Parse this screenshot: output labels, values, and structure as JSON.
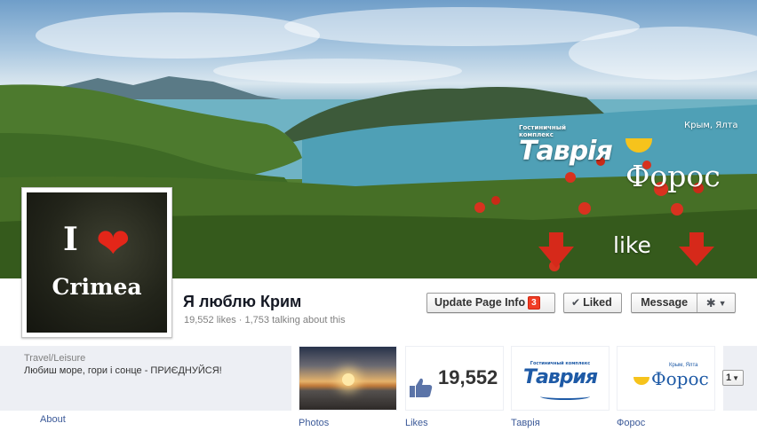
{
  "cover": {
    "brand_tavria": "Таврія",
    "brand_tavria_sub": "Гостиничный комплекс",
    "brand_foros": "Форос",
    "brand_foros_sub": "Крым, Ялта",
    "like_text": "like"
  },
  "profile_picture": {
    "line1": "I",
    "heart": "❤",
    "line2": "Crimea"
  },
  "page": {
    "name": "Я люблю Крим",
    "stats": "19,552 likes · 1,753 talking about this"
  },
  "actions": {
    "update_label": "Update Page Info",
    "update_badge": "3",
    "liked_check": "✔",
    "liked_label": "Liked",
    "message_label": "Message",
    "gear_icon": "✱",
    "caret": "▼"
  },
  "about": {
    "category": "Travel/Leisure",
    "description": "Любиш море, гори і сонце - ПРИЄДНУЙСЯ!",
    "link_label": "About"
  },
  "apps": {
    "photos_label": "Photos",
    "likes_label": "Likes",
    "likes_count": "19,552",
    "tavria_label": "Таврія",
    "tavria_logo": "Таврия",
    "tavria_logo_sub": "Гостиничный комплекс",
    "foros_label": "Форос",
    "foros_logo": "Форос",
    "foros_logo_sub": "Крым, Ялта",
    "more_count": "1"
  }
}
